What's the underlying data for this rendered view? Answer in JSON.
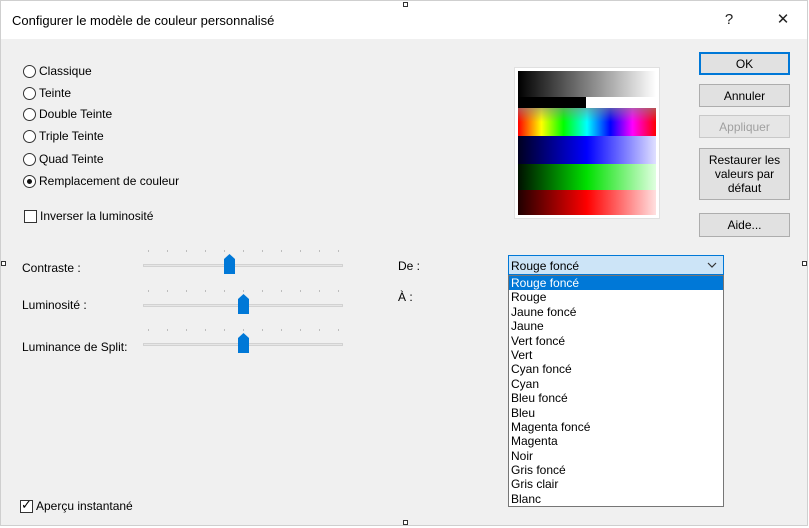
{
  "window": {
    "title": "Configurer le modèle de couleur personnalisé",
    "help_glyph": "?",
    "close_glyph": "✕"
  },
  "modes": [
    {
      "label": "Classique",
      "selected": false
    },
    {
      "label": "Teinte",
      "selected": false
    },
    {
      "label": "Double Teinte",
      "selected": false
    },
    {
      "label": "Triple Teinte",
      "selected": false
    },
    {
      "label": "Quad Teinte",
      "selected": false
    },
    {
      "label": "Remplacement de couleur",
      "selected": true
    }
  ],
  "invert": {
    "label": "Inverser la luminosité",
    "checked": false
  },
  "sliders": [
    {
      "label": "Contraste :",
      "value": 0.43
    },
    {
      "label": "Luminosité :",
      "value": 0.5
    },
    {
      "label": "Luminance de Split:",
      "value": 0.5
    }
  ],
  "from": {
    "label": "De :",
    "selected": "Rouge foncé"
  },
  "to": {
    "label": "À :"
  },
  "color_options": [
    "Rouge foncé",
    "Rouge",
    "Jaune foncé",
    "Jaune",
    "Vert foncé",
    "Vert",
    "Cyan foncé",
    "Cyan",
    "Bleu foncé",
    "Bleu",
    "Magenta foncé",
    "Magenta",
    "Noir",
    "Gris foncé",
    "Gris clair",
    "Blanc"
  ],
  "buttons": {
    "ok": "OK",
    "cancel": "Annuler",
    "apply": "Appliquer",
    "restore": "Restaurer les valeurs par défaut",
    "help": "Aide..."
  },
  "live_preview": {
    "label": "Aperçu instantané",
    "checked": true
  },
  "colors": {
    "accent": "#0078d7",
    "selection_bg": "#cce4f7"
  }
}
